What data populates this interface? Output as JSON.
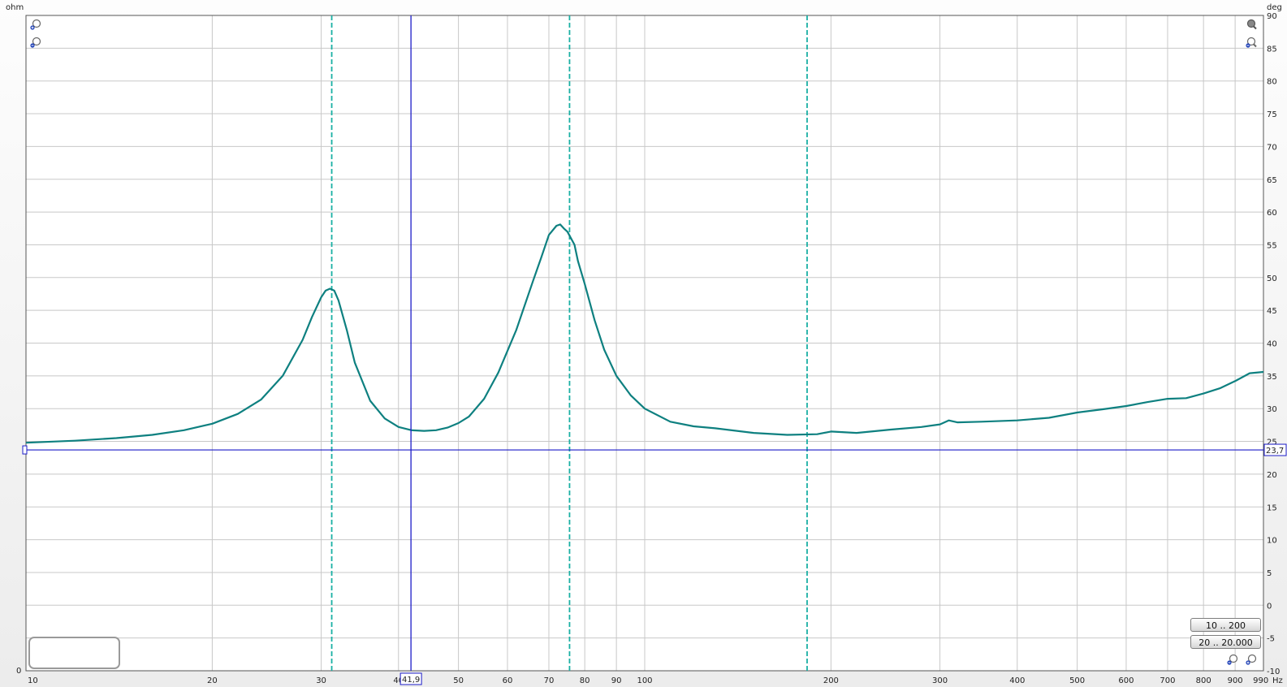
{
  "chart_data": {
    "type": "line",
    "xlabel": "Hz",
    "ylabel": "ohm",
    "y2label": "deg",
    "x_scale": "log",
    "xlim": [
      10,
      1000
    ],
    "ylim": [
      -10,
      90
    ],
    "grid": true,
    "x_ticks": [
      {
        "value": 10,
        "label": "10"
      },
      {
        "value": 20,
        "label": "20"
      },
      {
        "value": 30,
        "label": "30"
      },
      {
        "value": 40,
        "label": "40"
      },
      {
        "value": 50,
        "label": "50"
      },
      {
        "value": 60,
        "label": "60"
      },
      {
        "value": 70,
        "label": "70"
      },
      {
        "value": 80,
        "label": "80"
      },
      {
        "value": 90,
        "label": "90"
      },
      {
        "value": 100,
        "label": "100"
      },
      {
        "value": 200,
        "label": "200"
      },
      {
        "value": 300,
        "label": "300"
      },
      {
        "value": 400,
        "label": "400"
      },
      {
        "value": 500,
        "label": "500"
      },
      {
        "value": 600,
        "label": "600"
      },
      {
        "value": 700,
        "label": "700"
      },
      {
        "value": 800,
        "label": "800"
      },
      {
        "value": 900,
        "label": "900"
      },
      {
        "value": 990,
        "label": "990"
      }
    ],
    "y_ticks_right": [
      90,
      85,
      80,
      75,
      70,
      65,
      60,
      55,
      50,
      45,
      40,
      35,
      30,
      25,
      20,
      15,
      10,
      5,
      0,
      -5,
      -10
    ],
    "y_left_tick": "0",
    "series": [
      {
        "color": "#0e8080",
        "x": [
          10,
          12,
          14,
          16,
          18,
          20,
          22,
          24,
          26,
          28,
          29,
          30,
          30.5,
          31,
          31.5,
          32,
          33,
          34,
          36,
          38,
          40,
          42,
          44,
          46,
          48,
          50,
          52,
          55,
          58,
          62,
          66,
          68,
          70,
          72,
          73,
          74,
          75,
          77,
          78,
          80,
          83,
          86,
          90,
          95,
          100,
          110,
          120,
          130,
          150,
          170,
          190,
          200,
          220,
          250,
          280,
          300,
          310,
          320,
          350,
          400,
          450,
          500,
          550,
          600,
          650,
          700,
          750,
          800,
          850,
          900,
          950,
          1000
        ],
        "y": [
          24.8,
          25.1,
          25.5,
          26.0,
          26.7,
          27.7,
          29.2,
          31.4,
          35.0,
          40.5,
          44.0,
          47.0,
          48.0,
          48.3,
          48.0,
          46.5,
          42.0,
          37.0,
          31.2,
          28.5,
          27.2,
          26.7,
          26.6,
          26.7,
          27.1,
          27.8,
          28.8,
          31.5,
          35.5,
          42.0,
          49.5,
          53.0,
          56.5,
          57.9,
          58.1,
          57.5,
          57.0,
          55.0,
          52.5,
          49.0,
          43.5,
          39.0,
          35.0,
          32.0,
          30.0,
          28.0,
          27.3,
          27.0,
          26.3,
          26.0,
          26.1,
          26.5,
          26.3,
          26.8,
          27.2,
          27.6,
          28.2,
          27.9,
          28.0,
          28.2,
          28.6,
          29.4,
          29.9,
          30.4,
          31.0,
          31.5,
          31.6,
          32.3,
          33.1,
          34.2,
          35.4,
          35.6
        ]
      }
    ],
    "markers": {
      "dashed_vertical": [
        31.2,
        75.6,
        183
      ],
      "cursor_x": {
        "value": 41.9,
        "label": "41,9"
      },
      "cursor_y": {
        "value": 23.7,
        "label": "23,7"
      }
    }
  },
  "controls": {
    "range_button_1": "10 .. 200",
    "range_button_2": "20 .. 20.000"
  },
  "colors": {
    "curve": "#0e8080",
    "dashed_marker": "#1ab0a4",
    "cursor": "#1c1cc8",
    "grid": "#c8c8c8"
  }
}
